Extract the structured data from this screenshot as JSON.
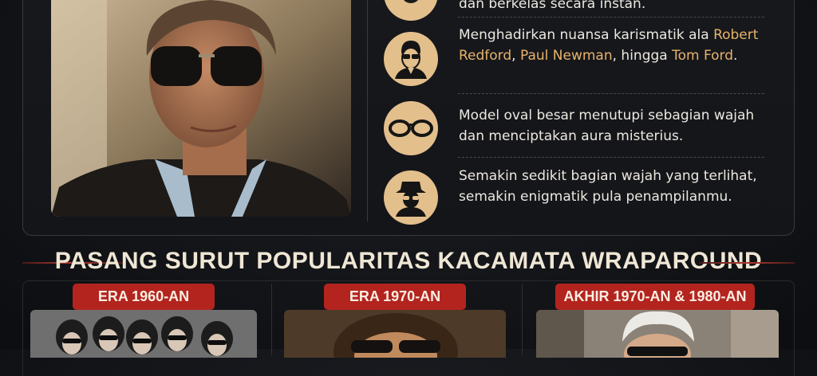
{
  "features": [
    {
      "icon": "glasses-icon",
      "text_parts": [
        {
          "t": "dan berkelas secara instan.",
          "hl": false
        }
      ]
    },
    {
      "icon": "man-with-sunglasses-icon",
      "text_parts": [
        {
          "t": "Menghadirkan nuansa karismatik ala ",
          "hl": false
        },
        {
          "t": "Robert Redford",
          "hl": true
        },
        {
          "t": ", ",
          "hl": false
        },
        {
          "t": "Paul Newman",
          "hl": true
        },
        {
          "t": ", hingga ",
          "hl": false
        },
        {
          "t": "Tom Ford",
          "hl": true
        },
        {
          "t": ".",
          "hl": false
        }
      ]
    },
    {
      "icon": "oval-sunglasses-icon",
      "text_parts": [
        {
          "t": "Model oval besar menutupi sebagian wajah dan menciptakan aura misterius.",
          "hl": false
        }
      ]
    },
    {
      "icon": "mystery-figure-icon",
      "text_parts": [
        {
          "t": "Semakin sedikit bagian wajah yang terlihat, semakin enigmatik pula penampilanmu.",
          "hl": false
        }
      ]
    }
  ],
  "section": {
    "title": "PASANG SURUT POPULARITAS KACAMATA WRAPAROUND"
  },
  "eras": [
    {
      "label": "ERA 1960-AN"
    },
    {
      "label": "ERA 1970-AN"
    },
    {
      "label": "AKHIR 1970-AN & 1980-AN"
    }
  ],
  "colors": {
    "accent": "#e8b36a",
    "badge": "#e3bf8c",
    "era_tag": "#b3241f",
    "background": "#121418"
  }
}
